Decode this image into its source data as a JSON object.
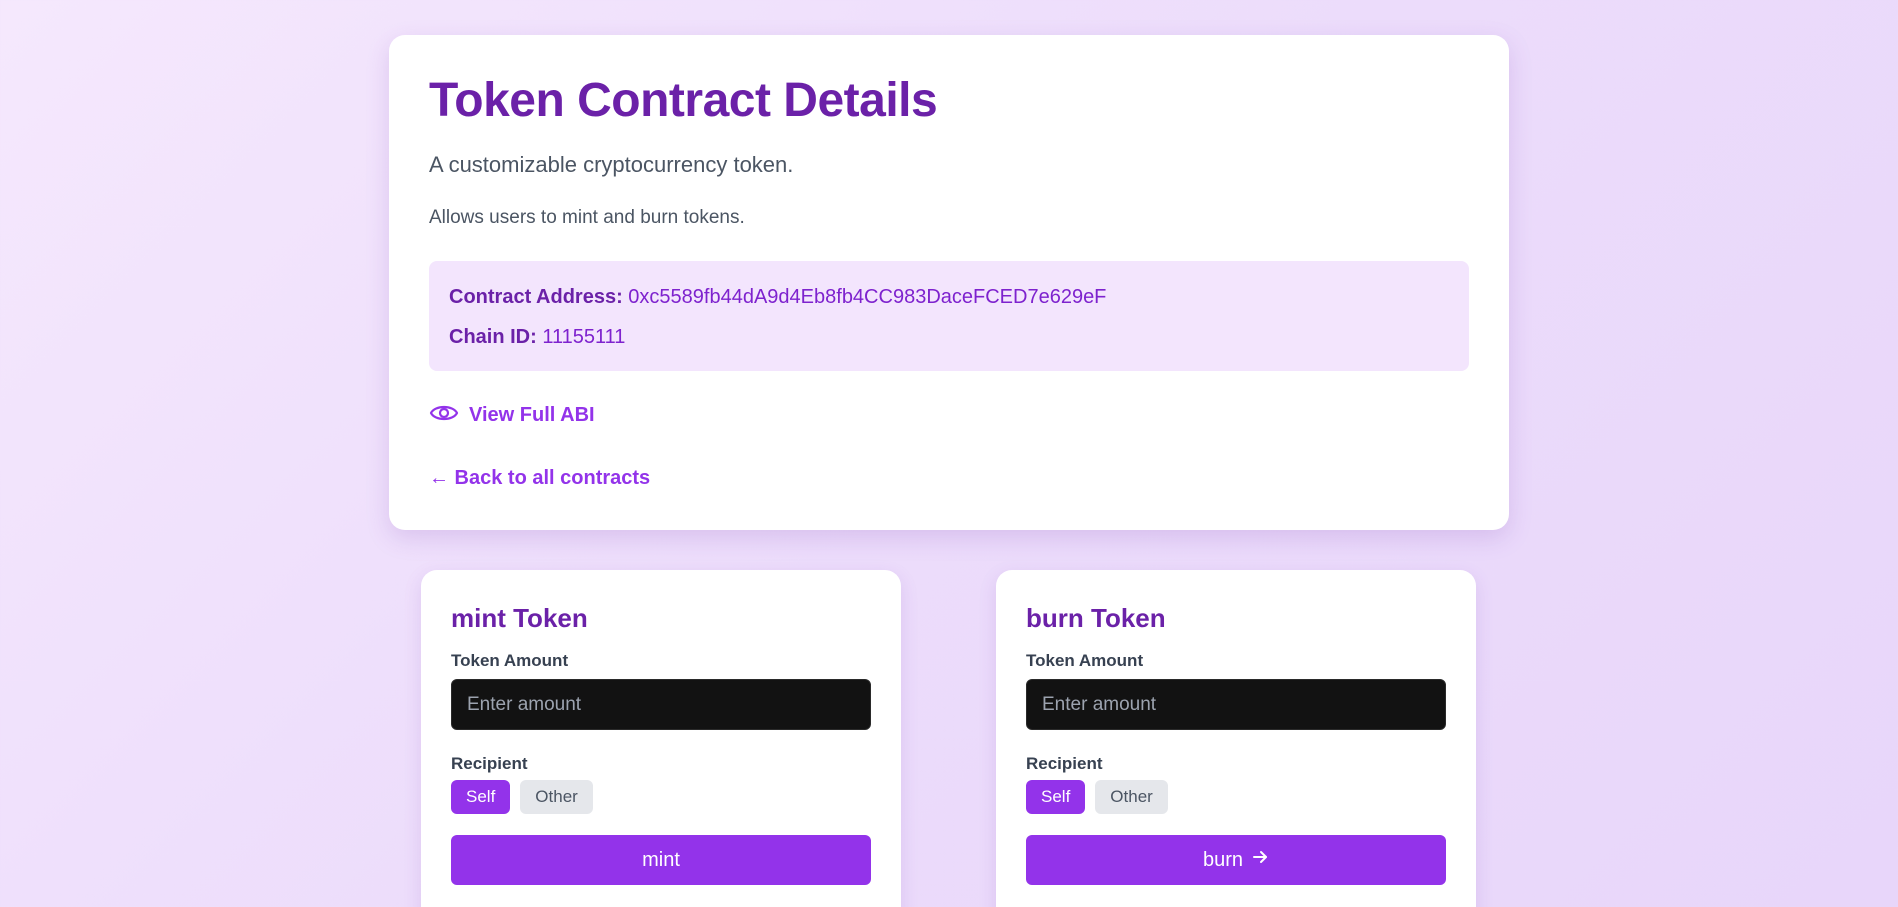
{
  "details": {
    "title": "Token Contract Details",
    "subtitle": "A customizable cryptocurrency token.",
    "description": "Allows users to mint and burn tokens.",
    "contract_address_label": "Contract Address:",
    "contract_address": "0xc5589fb44dA9d4Eb8fb4CC983DaceFCED7e629eF",
    "chain_id_label": "Chain ID:",
    "chain_id": "11155111",
    "view_abi_label": "View Full ABI",
    "back_label": "← Back to all contracts"
  },
  "mint": {
    "title": "mint Token",
    "amount_label": "Token Amount",
    "amount_placeholder": "Enter amount",
    "recipient_label": "Recipient",
    "self_label": "Self",
    "other_label": "Other",
    "submit_label": "mint"
  },
  "burn": {
    "title": "burn Token",
    "amount_label": "Token Amount",
    "amount_placeholder": "Enter amount",
    "recipient_label": "Recipient",
    "self_label": "Self",
    "other_label": "Other",
    "submit_label": "burn",
    "submit_icon": "arrow-right-icon"
  },
  "colors": {
    "accent": "#9333ea",
    "title": "#6b21a8",
    "info_bg": "#f3e5fd",
    "input_bg": "#121212"
  }
}
